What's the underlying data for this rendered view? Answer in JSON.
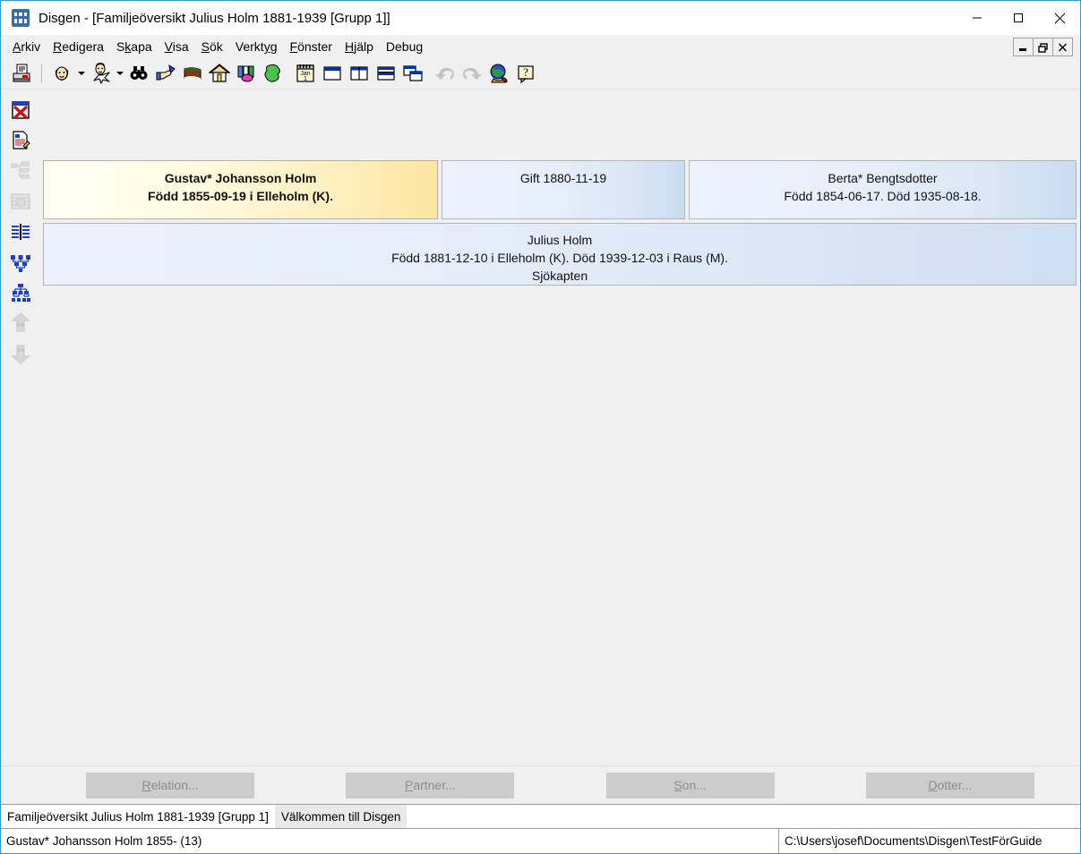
{
  "window": {
    "app_name": "Disgen",
    "title": "Disgen  - [Familjeöversikt Julius Holm 1881-1939 [Grupp 1]]",
    "icon": "disgen-logo-icon",
    "controls": {
      "minimize": "minimize-icon",
      "maximize": "maximize-icon",
      "close": "close-icon"
    },
    "mdi_controls": {
      "minimize": "mdi-minimize-icon",
      "restore": "mdi-restore-icon",
      "close": "mdi-close-icon"
    }
  },
  "menu": {
    "items": [
      {
        "label": "Arkiv",
        "accel": "A"
      },
      {
        "label": "Redigera",
        "accel": "R"
      },
      {
        "label": "Skapa",
        "accel": "k"
      },
      {
        "label": "Visa",
        "accel": "V"
      },
      {
        "label": "Sök",
        "accel": "S"
      },
      {
        "label": "Verktyg",
        "accel": "y"
      },
      {
        "label": "Fönster",
        "accel": "F"
      },
      {
        "label": "Hjälp",
        "accel": "H"
      },
      {
        "label": "Debug",
        "accel": ""
      }
    ]
  },
  "toolbar": {
    "items": [
      {
        "name": "print-icon"
      },
      {
        "name": "separator"
      },
      {
        "name": "person-icon"
      },
      {
        "name": "person-dropdown-arrow"
      },
      {
        "name": "person-search-icon"
      },
      {
        "name": "person-search-dropdown-arrow"
      },
      {
        "name": "binoculars-icon"
      },
      {
        "name": "pointing-hand-icon"
      },
      {
        "name": "book-icon"
      },
      {
        "name": "house-icon"
      },
      {
        "name": "books-shelf-icon"
      },
      {
        "name": "map-region-icon"
      },
      {
        "name": "calendar-icon"
      },
      {
        "name": "window-single-icon"
      },
      {
        "name": "window-split-vertical-icon"
      },
      {
        "name": "window-split-horizontal-icon"
      },
      {
        "name": "window-cascade-icon"
      },
      {
        "name": "undo-icon"
      },
      {
        "name": "redo-icon"
      },
      {
        "name": "globe-icon"
      },
      {
        "name": "help-icon"
      }
    ]
  },
  "sidebar": {
    "items": [
      {
        "name": "close-view-icon",
        "enabled": true
      },
      {
        "name": "edit-document-icon",
        "enabled": true
      },
      {
        "name": "tree-outline-icon",
        "enabled": false
      },
      {
        "name": "table-view-icon",
        "enabled": false
      },
      {
        "name": "family-overview-icon",
        "enabled": true
      },
      {
        "name": "ancestor-chart-icon",
        "enabled": true
      },
      {
        "name": "descendant-chart-icon",
        "enabled": true
      },
      {
        "name": "ancestors-up-icon",
        "enabled": false
      },
      {
        "name": "descendants-down-icon",
        "enabled": false
      }
    ]
  },
  "chart_cards": {
    "father": {
      "name": "Gustav* Johansson Holm",
      "details": "Född 1855-09-19 i Elleholm (K).",
      "style": "highlighted-yellow"
    },
    "marriage": {
      "text": "Gift 1880-11-19",
      "style": "blue"
    },
    "mother": {
      "name": "Berta* Bengtsdotter",
      "details": "Född 1854-06-17. Död 1935-08-18.",
      "style": "blue"
    },
    "child": {
      "name": "Julius Holm",
      "details": "Född 1881-12-10 i Elleholm (K). Död 1939-12-03 i Raus (M).",
      "occupation": "Sjökapten",
      "style": "blue"
    }
  },
  "action_buttons": [
    {
      "label": "Relation...",
      "accel": "R",
      "enabled": false
    },
    {
      "label": "Partner...",
      "accel": "P",
      "enabled": false
    },
    {
      "label": "Son...",
      "accel": "S",
      "enabled": false
    },
    {
      "label": "Dotter...",
      "accel": "D",
      "enabled": false
    }
  ],
  "tabs": [
    {
      "label": "Familjeöversikt Julius Holm 1881-1939 [Grupp 1]",
      "active": true
    },
    {
      "label": "Välkommen till Disgen",
      "active": false
    }
  ],
  "statusbar": {
    "left": "Gustav* Johansson Holm 1855- (13)",
    "right": "C:\\Users\\josef\\Documents\\Disgen\\TestFörGuide"
  },
  "colors": {
    "window_border": "#3399d6",
    "chrome": "#f0f0f0",
    "card_yellow_start": "#fffef4",
    "card_yellow_end": "#fbe5a1",
    "card_blue_start": "#edf3fc",
    "card_blue_end": "#cadcef",
    "disabled_text": "#8d8d8d"
  }
}
